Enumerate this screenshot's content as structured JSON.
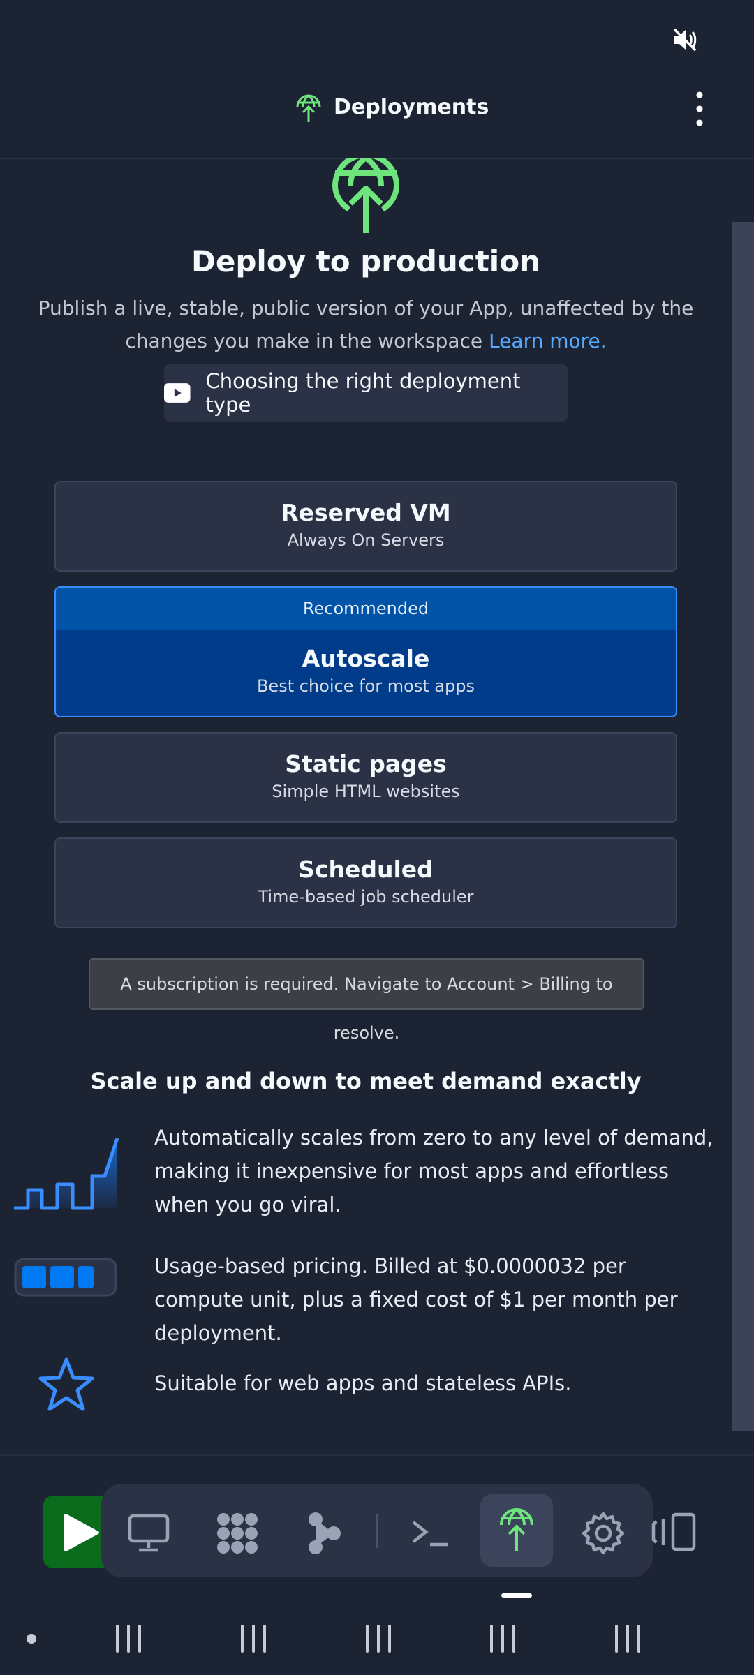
{
  "header": {
    "title": "Deployments"
  },
  "hero": {
    "title": "Deploy to production",
    "description": "Publish a live, stable, public version of your App, unaffected by the changes you make in the workspace",
    "learn_more": "Learn more.",
    "video_label": "Choosing the right deployment type"
  },
  "options": [
    {
      "title": "Reserved VM",
      "subtitle": "Always On Servers"
    },
    {
      "badge": "Recommended",
      "title": "Autoscale",
      "subtitle": "Best choice for most apps"
    },
    {
      "title": "Static pages",
      "subtitle": "Simple HTML websites"
    },
    {
      "title": "Scheduled",
      "subtitle": "Time-based job scheduler"
    }
  ],
  "notice": "A subscription is required. Navigate to Account > Billing to resolve.",
  "features": {
    "title": "Scale up and down to meet demand exactly",
    "items": [
      {
        "icon": "scaling-chart-icon",
        "text": "Automatically scales from zero to any level of demand, making it inexpensive for most apps and effortless when you go viral."
      },
      {
        "icon": "battery-icon",
        "text": "Usage-based pricing. Billed at $0.0000032 per compute unit, plus a fixed cost of $1 per month per deployment."
      },
      {
        "icon": "star-icon",
        "text": "Suitable for web apps and stateless APIs."
      }
    ]
  },
  "colors": {
    "background": "#1c2333",
    "accent_green": "#6ee57c",
    "link_blue": "#57abff",
    "selected_blue": "#003c8a"
  },
  "toolbar": {
    "tools": [
      "run-icon",
      "monitor-icon",
      "packages-icon",
      "nodes-icon",
      "shell-icon",
      "deploy-icon",
      "settings-icon",
      "split-view-icon"
    ],
    "active": "deploy-icon"
  }
}
